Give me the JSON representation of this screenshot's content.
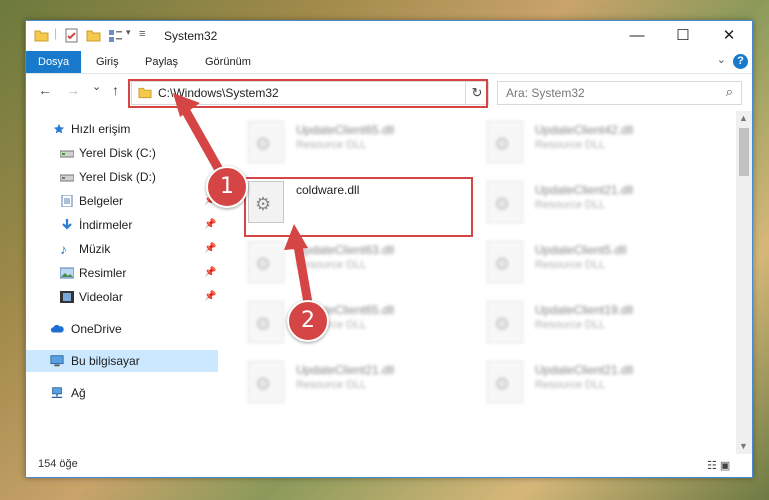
{
  "window": {
    "title": "System32"
  },
  "titlebar": {
    "minimize": "—",
    "maximize": "☐",
    "close": "✕"
  },
  "ribbon": {
    "tabs": [
      "Dosya",
      "Giriş",
      "Paylaş",
      "Görünüm"
    ],
    "help": "?"
  },
  "nav": {
    "back": "←",
    "forward": "→",
    "recent": "⌄",
    "up": "↑",
    "address": "C:\\Windows\\System32",
    "search_placeholder": "Ara: System32"
  },
  "sidebar": {
    "items": [
      {
        "label": "Hızlı erişim",
        "icon": "star-icon"
      },
      {
        "label": "Yerel Disk (C:)",
        "icon": "drive-icon"
      },
      {
        "label": "Yerel Disk (D:)",
        "icon": "drive-icon"
      },
      {
        "label": "Belgeler",
        "icon": "documents-icon"
      },
      {
        "label": "İndirmeler",
        "icon": "download-icon"
      },
      {
        "label": "Müzik",
        "icon": "music-icon"
      },
      {
        "label": "Resimler",
        "icon": "pictures-icon"
      },
      {
        "label": "Videolar",
        "icon": "videos-icon"
      },
      {
        "label": "OneDrive",
        "icon": "cloud-icon"
      },
      {
        "label": "Bu bilgisayar",
        "icon": "computer-icon"
      },
      {
        "label": "Ağ",
        "icon": "network-icon"
      }
    ]
  },
  "files": {
    "highlighted": {
      "name": "coldware.dll",
      "type": ""
    },
    "others": [
      {
        "name": "UpdateClient65.dll",
        "type": "Resource DLL"
      },
      {
        "name": "UpdateClient42.dll",
        "type": "Resource DLL"
      },
      {
        "name": "UpdateClient21.dll",
        "type": "Resource DLL"
      },
      {
        "name": "UpdateClient63.dll",
        "type": "Resource DLL"
      },
      {
        "name": "UpdateClient5.dll",
        "type": "Resource DLL"
      },
      {
        "name": "UpdateClient65.dll",
        "type": "Resource DLL"
      },
      {
        "name": "UpdateClient19.dll",
        "type": "Resource DLL"
      },
      {
        "name": "UpdateClient21.dll",
        "type": "Resource DLL"
      },
      {
        "name": "UpdateClient21.dll",
        "type": "Resource DLL"
      }
    ]
  },
  "status": {
    "count": "154 öğe"
  },
  "annotations": {
    "step1": "1",
    "step2": "2"
  },
  "colors": {
    "accent": "#1979ca",
    "annotation": "#d64545"
  }
}
